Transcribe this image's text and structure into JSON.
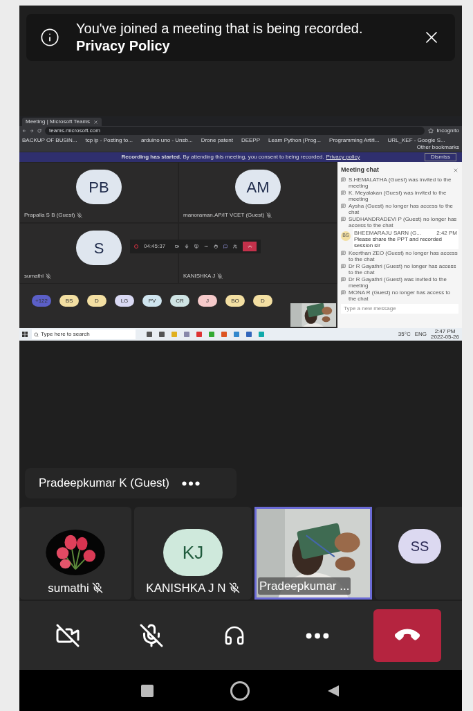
{
  "banner": {
    "text": "You've joined a meeting that is being recorded. **Privacy Policy**"
  },
  "shared_screen": {
    "browser": {
      "tab_title": "Meeting | Microsoft Teams",
      "url": "teams.microsoft.com",
      "profile": "Incognito",
      "bookmarks": [
        "BACKUP OF BUSIN...",
        "tcp ip - Posting to...",
        "arduino uno - Unsb...",
        "Drone patent",
        "DEEPP",
        "Learn Python (Prog...",
        "Programming Artifi...",
        "URL_KEF - Google S..."
      ],
      "other_bookmarks": "Other bookmarks"
    },
    "recording_bar": {
      "title": "Recording has started.",
      "text": "By attending this meeting, you consent to being recorded.",
      "link": "Privacy policy",
      "button": "Dismiss"
    },
    "tiles": [
      {
        "initials": "PB",
        "name": "Prapalla S B (Guest)"
      },
      {
        "initials": "AM",
        "name": "manoraman.AP/IT VCET (Guest)"
      },
      {
        "initials": "S",
        "name": "sumathi"
      },
      {
        "name": "KANISHKA J"
      }
    ],
    "toolbar": {
      "timer": "04:45:37"
    },
    "roster": [
      {
        "initials": "+122",
        "color": "#5b5fc7"
      },
      {
        "initials": "BS",
        "color": "#f3dfa2"
      },
      {
        "initials": "D",
        "color": "#f3dfa2"
      },
      {
        "initials": "LG",
        "color": "#d9d9f3"
      },
      {
        "initials": "PV",
        "color": "#cfe4ee"
      },
      {
        "initials": "CR",
        "color": "#cfe4e4"
      },
      {
        "initials": "J",
        "color": "#f6caca"
      },
      {
        "initials": "BO",
        "color": "#f3dfa2"
      },
      {
        "initials": "D",
        "color": "#f3dfa2"
      }
    ],
    "chat": {
      "title": "Meeting chat",
      "items": [
        {
          "kind": "event",
          "text": "S.HEMALATHA (Guest) was invited to the meeting"
        },
        {
          "kind": "event",
          "text": "K. Meyalakan (Guest) was invited to the meeting"
        },
        {
          "kind": "event",
          "text": "Aysha (Guest) no longer has access to the chat"
        },
        {
          "kind": "event",
          "text": "SUDHANDRADEVI P (Guest) no longer has access to the chat"
        },
        {
          "kind": "message",
          "initials": "BS",
          "sender": "BHEEMARAJU SARN (G...",
          "time": "2:42 PM",
          "text": "Please share the PPT and recorded session sir"
        },
        {
          "kind": "event",
          "text": "Keerthan ZEO (Guest) no longer has access to the chat"
        },
        {
          "kind": "event",
          "text": "Dr R Gayathri (Guest) no longer has access to the chat"
        },
        {
          "kind": "event",
          "text": "Dr R Gayathri (Guest) was invited to the meeting"
        },
        {
          "kind": "event",
          "text": "MONA R (Guest) no longer has access to the chat"
        }
      ],
      "placeholder": "Type a new message"
    },
    "taskbar": {
      "search_placeholder": "Type here to search",
      "temperature": "35°C",
      "language": "ENG",
      "time": "2:47 PM",
      "date": "2022-05-26"
    }
  },
  "speaker": {
    "name": "Pradeepkumar K (Guest)"
  },
  "tiles": [
    {
      "kind": "picture-avatar",
      "name": "sumathi",
      "muted": true,
      "selected": false
    },
    {
      "kind": "initials",
      "initials": "KJ",
      "name": "KANISHKA J N",
      "muted": true,
      "selected": false
    },
    {
      "kind": "video",
      "name": "Pradeepkumar ...",
      "muted": false,
      "selected": true
    },
    {
      "kind": "initials",
      "initials": "SS",
      "selected": false
    }
  ],
  "controls": {
    "camera_on": false,
    "mic_on": false
  }
}
